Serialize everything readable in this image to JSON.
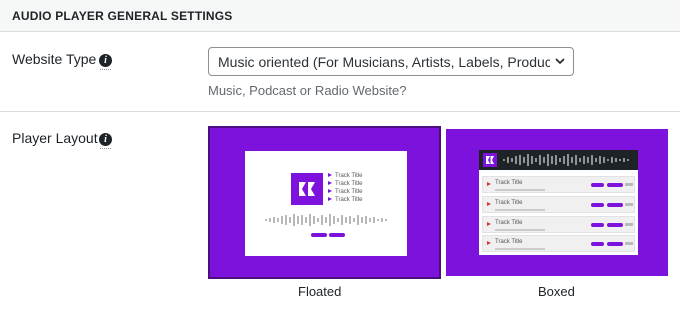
{
  "header": {
    "title": "AUDIO PLAYER GENERAL SETTINGS"
  },
  "website_type": {
    "label": "Website Type",
    "info_icon": "info-icon",
    "selected": "Music oriented (For Musicians, Artists, Labels, Producers...)",
    "help": "Music, Podcast or Radio Website?"
  },
  "player_layout": {
    "label": "Player Layout",
    "info_icon": "info-icon",
    "options": [
      {
        "label": "Floated",
        "selected": true
      },
      {
        "label": "Boxed",
        "selected": false
      }
    ],
    "thumbnail_track_title": "Track Title"
  },
  "colors": {
    "accent": "#7e12dd",
    "selected_border": "#4a0f7d",
    "track_marker": "#d63638"
  }
}
